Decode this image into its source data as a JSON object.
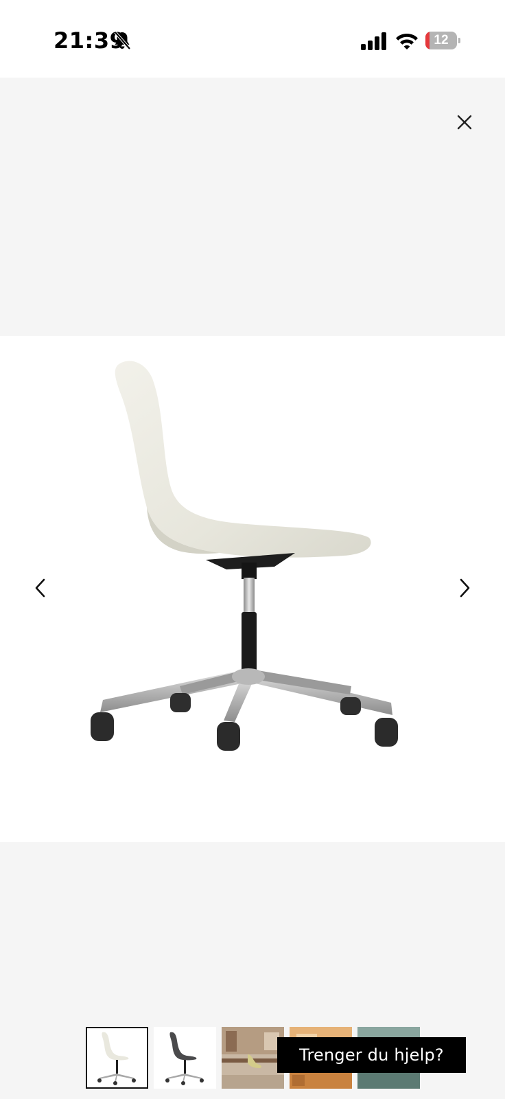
{
  "status_bar": {
    "time": "21:39",
    "battery_level": "12",
    "battery_fraction": 0.12,
    "icons": [
      "bell-slash-icon",
      "cellular-signal-icon",
      "wifi-icon",
      "battery-icon"
    ]
  },
  "gallery": {
    "close_icon": "close-icon",
    "prev_icon": "chevron-left-icon",
    "next_icon": "chevron-right-icon",
    "main_image": "white-shell-swivel-office-chair",
    "thumbnails": [
      {
        "image": "white-chair-thumbnail",
        "selected": true
      },
      {
        "image": "dark-grey-chair-thumbnail",
        "selected": false
      },
      {
        "image": "chair-in-home-office-thumbnail",
        "selected": false
      },
      {
        "image": "chair-in-wood-room-thumbnail",
        "selected": false
      },
      {
        "image": "chair-in-teal-room-thumbnail",
        "selected": false
      }
    ]
  },
  "help_button": {
    "label": "Trenger du hjelp?"
  },
  "colors": {
    "page_background": "#f5f5f5",
    "image_background": "#ffffff",
    "help_button_background": "#000000",
    "battery_low": "#e5383b"
  }
}
